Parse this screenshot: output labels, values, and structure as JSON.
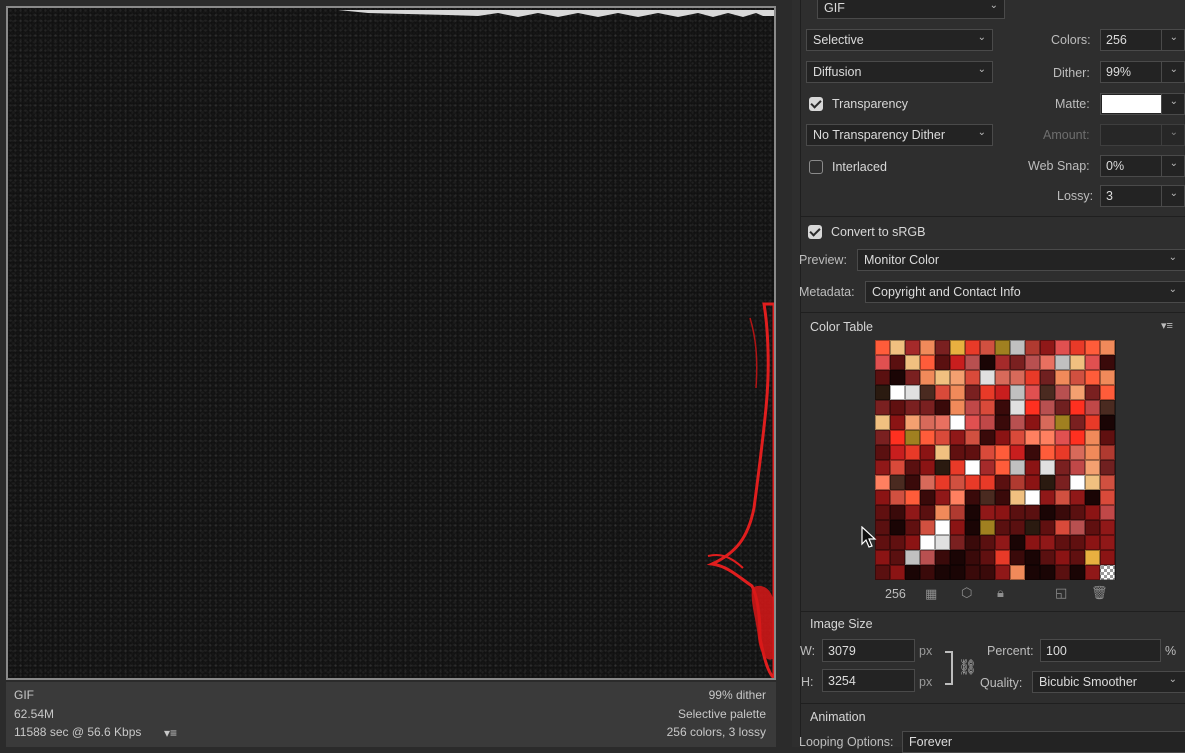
{
  "preview": {
    "format": "GIF",
    "size": "62.54M",
    "time": "11588 sec @ 56.6 Kbps",
    "dither": "99% dither",
    "palette": "Selective palette",
    "colors": "256 colors, 3 lossy",
    "menu_icon": "menu-icon"
  },
  "settings": {
    "format": "GIF",
    "reduction": "Selective",
    "dither_algo": "Diffusion",
    "transparency_label": "Transparency",
    "transparency_checked": true,
    "transparency_dither": "No Transparency Dither",
    "interlaced_label": "Interlaced",
    "interlaced_checked": false,
    "colors_label": "Colors:",
    "colors_value": "256",
    "dither_label": "Dither:",
    "dither_value": "99%",
    "matte_label": "Matte:",
    "matte_color": "#ffffff",
    "amount_label": "Amount:",
    "amount_value": "",
    "websnap_label": "Web Snap:",
    "websnap_value": "0%",
    "lossy_label": "Lossy:",
    "lossy_value": "3",
    "convert_label": "Convert to sRGB",
    "convert_checked": true,
    "preview_label": "Preview:",
    "preview_value": "Monitor Color",
    "metadata_label": "Metadata:",
    "metadata_value": "Copyright and Contact Info"
  },
  "color_table": {
    "title": "Color Table",
    "count": "256"
  },
  "image_size": {
    "title": "Image Size",
    "w_label": "W:",
    "w_value": "3079",
    "h_label": "H:",
    "h_value": "3254",
    "unit": "px",
    "percent_label": "Percent:",
    "percent_value": "100",
    "percent_unit": "%",
    "quality_label": "Quality:",
    "quality_value": "Bicubic Smoother"
  },
  "animation": {
    "title": "Animation",
    "looping_label": "Looping Options:",
    "looping_value": "Forever"
  },
  "colors": {
    "palette": [
      "#8b1414",
      "#c81e1e",
      "#e83a28",
      "#a52a2a",
      "#d94a3a",
      "#5a1010",
      "#e87060",
      "#f08a5a",
      "#3a0a0a",
      "#b03a30",
      "#f4a070",
      "#d86a5a",
      "#ffffff",
      "#c0c0c0",
      "#7a2020",
      "#ff5c3a",
      "#e8b040",
      "#f0c080",
      "#a08020",
      "#2a1a10",
      "#4a2a20",
      "#e05050",
      "#ff8060",
      "#c04848",
      "#e0e0e0",
      "#901818",
      "#601010",
      "#ff3020",
      "#d05040",
      "#702020",
      "#b85050",
      "#1a0505"
    ]
  }
}
